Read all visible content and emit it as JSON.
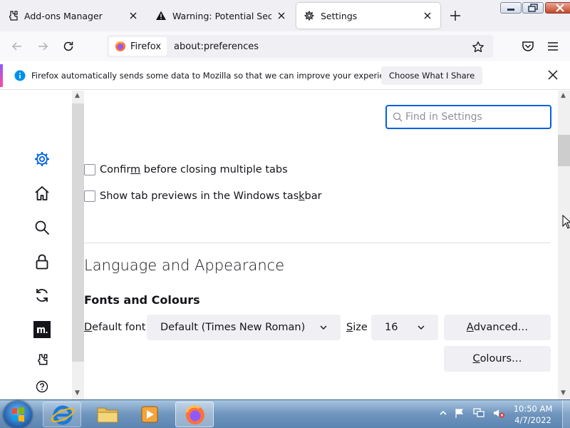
{
  "tabs": [
    {
      "title": "Add-ons Manager",
      "icon": "puzzle-icon"
    },
    {
      "title": "Warning: Potential Security Risk Ahead",
      "icon": "warning-icon"
    },
    {
      "title": "Settings",
      "icon": "gear-icon"
    }
  ],
  "navbar": {
    "identity_label": "Firefox",
    "url": "about:preferences"
  },
  "notification": {
    "message": "Firefox automatically sends some data to Mozilla so that we can improve your experience.",
    "button_label": "Choose What I Share"
  },
  "settings": {
    "search_placeholder": "Find in Settings",
    "tabs_options": [
      {
        "pre": "Confir",
        "key": "m",
        "post": " before closing multiple tabs"
      },
      {
        "pre": "Show tab previews in the Windows tas",
        "key": "k",
        "post": "bar"
      }
    ],
    "section_heading": "Language and Appearance",
    "subsection_heading": "Fonts and Colours",
    "default_font_label_key": "D",
    "default_font_label_rest": "efault font",
    "default_font_value": "Default (Times New Roman)",
    "size_label_key": "S",
    "size_label_rest": "ize",
    "size_value": "16",
    "advanced_key": "A",
    "advanced_rest": "dvanced…",
    "colours_key": "C",
    "colours_rest": "olours…"
  },
  "taskbar": {
    "time": "10:50 AM",
    "date": "4/7/2022"
  },
  "colors": {
    "accent": "#0061e0",
    "notification_gradient_start": "#9059ff",
    "notification_gradient_end": "#ff4aa2"
  }
}
